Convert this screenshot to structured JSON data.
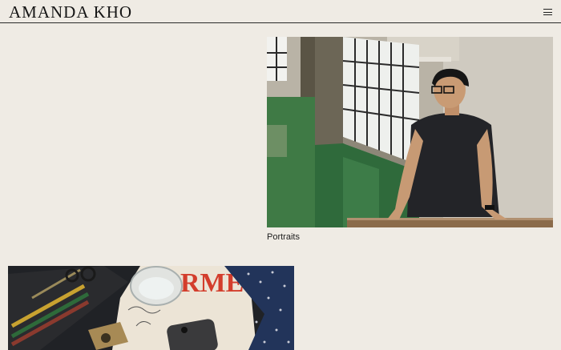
{
  "site": {
    "logo": "AMANDA KHO",
    "menu_icon": "hamburger-menu-icon"
  },
  "gallery": {
    "items": [
      {
        "caption": "Portraits",
        "image": "portrait-photo"
      },
      {
        "caption": "",
        "image": "still-life-photo"
      }
    ]
  },
  "colors": {
    "background": "#efebe4",
    "text": "#1b1b1b",
    "rule": "#2a2a2a"
  }
}
